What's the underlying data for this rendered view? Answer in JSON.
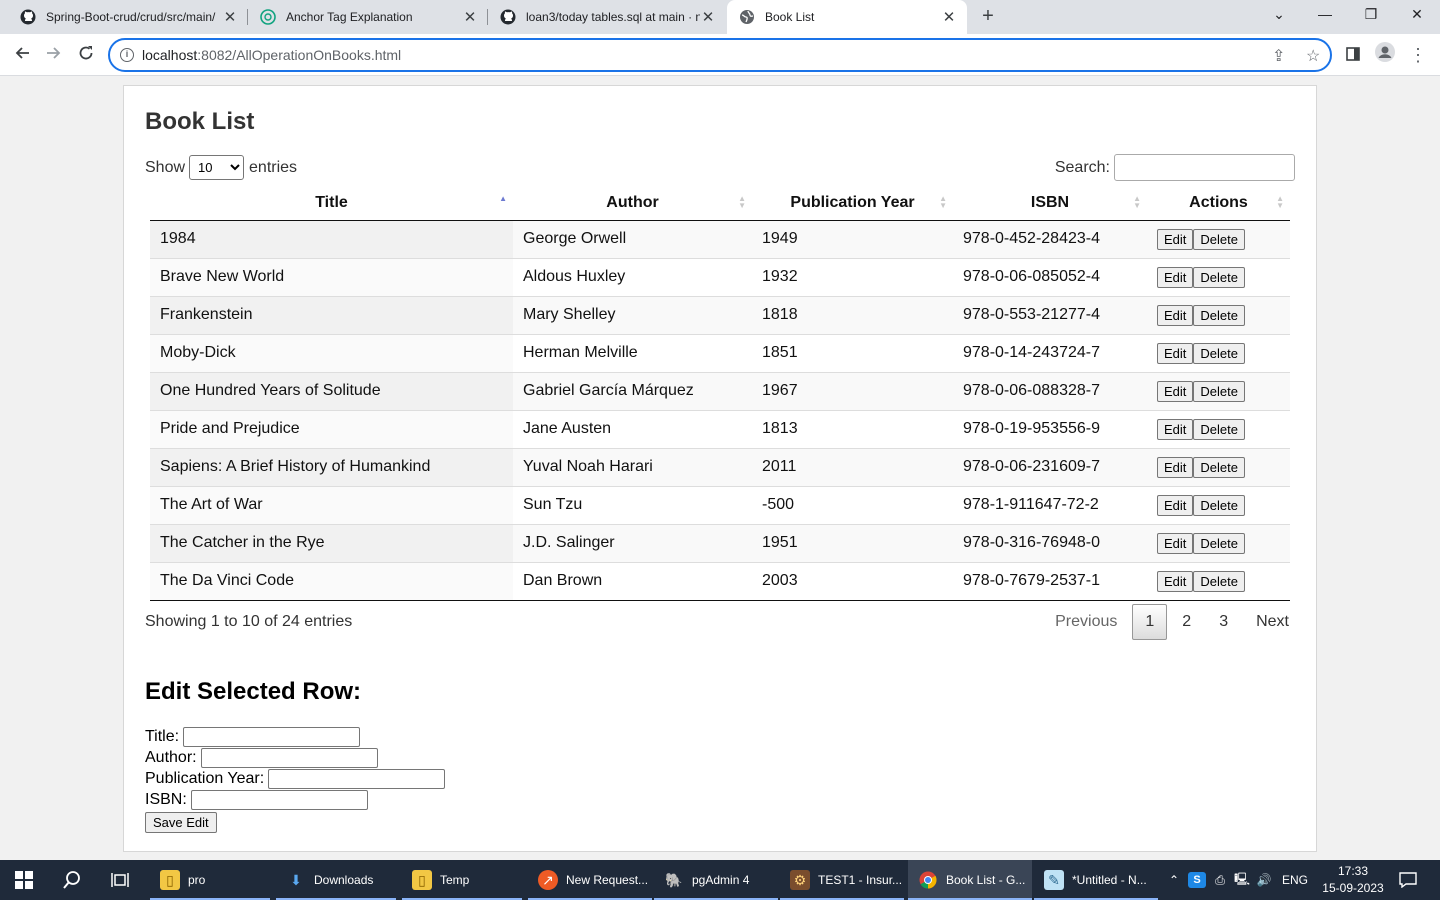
{
  "browser": {
    "tabs": [
      {
        "title": "Spring-Boot-crud/crud/src/main/",
        "icon": "github-icon"
      },
      {
        "title": "Anchor Tag Explanation",
        "icon": "chatgpt-icon"
      },
      {
        "title": "loan3/today tables.sql at main · n",
        "icon": "github-icon"
      },
      {
        "title": "Book List",
        "icon": "globe-icon"
      }
    ],
    "url_host": "localhost",
    "url_rest": ":8082/AllOperationOnBooks.html"
  },
  "page": {
    "heading": "Book List",
    "length": {
      "show": "Show",
      "value": "10",
      "entries": "entries"
    },
    "search_label": "Search:",
    "columns": [
      "Title",
      "Author",
      "Publication Year",
      "ISBN",
      "Actions"
    ],
    "rows": [
      {
        "title": "1984",
        "author": "George Orwell",
        "year": "1949",
        "isbn": "978-0-452-28423-4"
      },
      {
        "title": "Brave New World",
        "author": "Aldous Huxley",
        "year": "1932",
        "isbn": "978-0-06-085052-4"
      },
      {
        "title": "Frankenstein",
        "author": "Mary Shelley",
        "year": "1818",
        "isbn": "978-0-553-21277-4"
      },
      {
        "title": "Moby-Dick",
        "author": "Herman Melville",
        "year": "1851",
        "isbn": "978-0-14-243724-7"
      },
      {
        "title": "One Hundred Years of Solitude",
        "author": "Gabriel García Márquez",
        "year": "1967",
        "isbn": "978-0-06-088328-7"
      },
      {
        "title": "Pride and Prejudice",
        "author": "Jane Austen",
        "year": "1813",
        "isbn": "978-0-19-953556-9"
      },
      {
        "title": "Sapiens: A Brief History of Humankind",
        "author": "Yuval Noah Harari",
        "year": "2011",
        "isbn": "978-0-06-231609-7"
      },
      {
        "title": "The Art of War",
        "author": "Sun Tzu",
        "year": "-500",
        "isbn": "978-1-911647-72-2"
      },
      {
        "title": "The Catcher in the Rye",
        "author": "J.D. Salinger",
        "year": "1951",
        "isbn": "978-0-316-76948-0"
      },
      {
        "title": "The Da Vinci Code",
        "author": "Dan Brown",
        "year": "2003",
        "isbn": "978-0-7679-2537-1"
      }
    ],
    "edit_label": "Edit",
    "delete_label": "Delete",
    "info": "Showing 1 to 10 of 24 entries",
    "pagination": {
      "previous": "Previous",
      "pages": [
        "1",
        "2",
        "3"
      ],
      "current": "1",
      "next": "Next"
    },
    "edit_form": {
      "heading": "Edit Selected Row:",
      "title_label": "Title:",
      "author_label": "Author:",
      "year_label": "Publication Year:",
      "isbn_label": "ISBN:",
      "save_label": "Save Edit"
    }
  },
  "taskbar": {
    "items": [
      {
        "label": "pro",
        "icon": "folder-icon"
      },
      {
        "label": "Downloads",
        "icon": "download-icon"
      },
      {
        "label": "Temp",
        "icon": "folder-icon"
      },
      {
        "label": "New Request...",
        "icon": "postman-icon"
      },
      {
        "label": "pgAdmin 4",
        "icon": "elephant-icon"
      },
      {
        "label": "TEST1 - Insur...",
        "icon": "app-icon"
      },
      {
        "label": "Book List - G...",
        "icon": "chrome-icon"
      },
      {
        "label": "*Untitled - N...",
        "icon": "notepad-icon"
      }
    ],
    "language": "ENG",
    "time": "17:33",
    "date": "15-09-2023"
  }
}
